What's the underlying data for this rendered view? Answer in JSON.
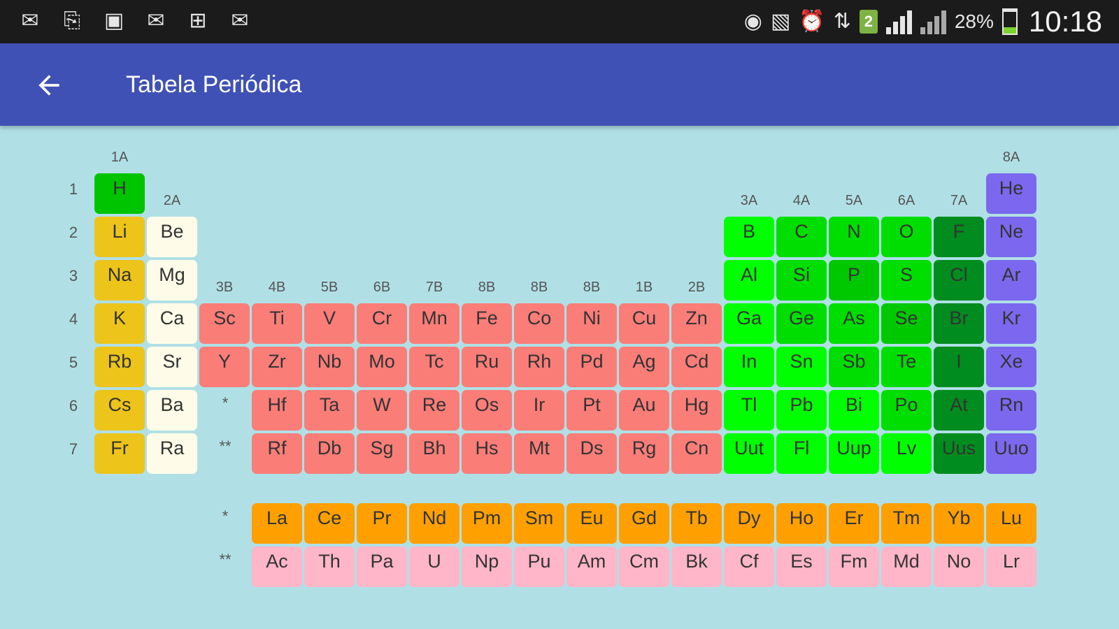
{
  "status_bar": {
    "left_icons": [
      "mail-icon",
      "sync-icon",
      "image-icon",
      "gmail-icon",
      "windows-icon",
      "gmail-icon"
    ],
    "sim_number": "2",
    "battery_percent": "28%",
    "battery_level": 0.28,
    "time": "10:18"
  },
  "app_bar": {
    "title": "Tabela Periódica"
  },
  "colors": {
    "alkali": "#ecc41a",
    "alkaline": "#fefce8",
    "transition": "#fa7d78",
    "lanthanide": "#ffa000",
    "actinide": "#ffb6c8",
    "hydrogen": "#00c400",
    "nonmetal": "#00dd00",
    "other_metal": "#00ff00",
    "metalloid": "#00c800",
    "halogen": "#008c1e",
    "noble": "#7b68ee"
  },
  "period_labels": [
    "1",
    "2",
    "3",
    "4",
    "5",
    "6",
    "7"
  ],
  "group_labels": [
    "1A",
    "2A",
    "3B",
    "4B",
    "5B",
    "6B",
    "7B",
    "8B",
    "8B",
    "8B",
    "1B",
    "2B",
    "3A",
    "4A",
    "5A",
    "6A",
    "7A",
    "8A"
  ],
  "star_labels": {
    "p6": "*",
    "p7": "**",
    "lanthanides": "*",
    "actinides": "**"
  },
  "main_table": [
    {
      "symbol": "H",
      "period": 1,
      "group": 1,
      "type": "hydrogen"
    },
    {
      "symbol": "He",
      "period": 1,
      "group": 18,
      "type": "noble"
    },
    {
      "symbol": "Li",
      "period": 2,
      "group": 1,
      "type": "alkali"
    },
    {
      "symbol": "Be",
      "period": 2,
      "group": 2,
      "type": "alkaline"
    },
    {
      "symbol": "B",
      "period": 2,
      "group": 13,
      "type": "other_metal"
    },
    {
      "symbol": "C",
      "period": 2,
      "group": 14,
      "type": "nonmetal"
    },
    {
      "symbol": "N",
      "period": 2,
      "group": 15,
      "type": "nonmetal"
    },
    {
      "symbol": "O",
      "period": 2,
      "group": 16,
      "type": "nonmetal"
    },
    {
      "symbol": "F",
      "period": 2,
      "group": 17,
      "type": "halogen"
    },
    {
      "symbol": "Ne",
      "period": 2,
      "group": 18,
      "type": "noble"
    },
    {
      "symbol": "Na",
      "period": 3,
      "group": 1,
      "type": "alkali"
    },
    {
      "symbol": "Mg",
      "period": 3,
      "group": 2,
      "type": "alkaline"
    },
    {
      "symbol": "Al",
      "period": 3,
      "group": 13,
      "type": "other_metal"
    },
    {
      "symbol": "Si",
      "period": 3,
      "group": 14,
      "type": "nonmetal"
    },
    {
      "symbol": "P",
      "period": 3,
      "group": 15,
      "type": "metalloid"
    },
    {
      "symbol": "S",
      "period": 3,
      "group": 16,
      "type": "nonmetal"
    },
    {
      "symbol": "Cl",
      "period": 3,
      "group": 17,
      "type": "halogen"
    },
    {
      "symbol": "Ar",
      "period": 3,
      "group": 18,
      "type": "noble"
    },
    {
      "symbol": "K",
      "period": 4,
      "group": 1,
      "type": "alkali"
    },
    {
      "symbol": "Ca",
      "period": 4,
      "group": 2,
      "type": "alkaline"
    },
    {
      "symbol": "Sc",
      "period": 4,
      "group": 3,
      "type": "transition"
    },
    {
      "symbol": "Ti",
      "period": 4,
      "group": 4,
      "type": "transition"
    },
    {
      "symbol": "V",
      "period": 4,
      "group": 5,
      "type": "transition"
    },
    {
      "symbol": "Cr",
      "period": 4,
      "group": 6,
      "type": "transition"
    },
    {
      "symbol": "Mn",
      "period": 4,
      "group": 7,
      "type": "transition"
    },
    {
      "symbol": "Fe",
      "period": 4,
      "group": 8,
      "type": "transition"
    },
    {
      "symbol": "Co",
      "period": 4,
      "group": 9,
      "type": "transition"
    },
    {
      "symbol": "Ni",
      "period": 4,
      "group": 10,
      "type": "transition"
    },
    {
      "symbol": "Cu",
      "period": 4,
      "group": 11,
      "type": "transition"
    },
    {
      "symbol": "Zn",
      "period": 4,
      "group": 12,
      "type": "transition"
    },
    {
      "symbol": "Ga",
      "period": 4,
      "group": 13,
      "type": "other_metal"
    },
    {
      "symbol": "Ge",
      "period": 4,
      "group": 14,
      "type": "nonmetal"
    },
    {
      "symbol": "As",
      "period": 4,
      "group": 15,
      "type": "nonmetal"
    },
    {
      "symbol": "Se",
      "period": 4,
      "group": 16,
      "type": "metalloid"
    },
    {
      "symbol": "Br",
      "period": 4,
      "group": 17,
      "type": "halogen"
    },
    {
      "symbol": "Kr",
      "period": 4,
      "group": 18,
      "type": "noble"
    },
    {
      "symbol": "Rb",
      "period": 5,
      "group": 1,
      "type": "alkali"
    },
    {
      "symbol": "Sr",
      "period": 5,
      "group": 2,
      "type": "alkaline"
    },
    {
      "symbol": "Y",
      "period": 5,
      "group": 3,
      "type": "transition"
    },
    {
      "symbol": "Zr",
      "period": 5,
      "group": 4,
      "type": "transition"
    },
    {
      "symbol": "Nb",
      "period": 5,
      "group": 5,
      "type": "transition"
    },
    {
      "symbol": "Mo",
      "period": 5,
      "group": 6,
      "type": "transition"
    },
    {
      "symbol": "Tc",
      "period": 5,
      "group": 7,
      "type": "transition"
    },
    {
      "symbol": "Ru",
      "period": 5,
      "group": 8,
      "type": "transition"
    },
    {
      "symbol": "Rh",
      "period": 5,
      "group": 9,
      "type": "transition"
    },
    {
      "symbol": "Pd",
      "period": 5,
      "group": 10,
      "type": "transition"
    },
    {
      "symbol": "Ag",
      "period": 5,
      "group": 11,
      "type": "transition"
    },
    {
      "symbol": "Cd",
      "period": 5,
      "group": 12,
      "type": "transition"
    },
    {
      "symbol": "In",
      "period": 5,
      "group": 13,
      "type": "other_metal"
    },
    {
      "symbol": "Sn",
      "period": 5,
      "group": 14,
      "type": "other_metal"
    },
    {
      "symbol": "Sb",
      "period": 5,
      "group": 15,
      "type": "nonmetal"
    },
    {
      "symbol": "Te",
      "period": 5,
      "group": 16,
      "type": "nonmetal"
    },
    {
      "symbol": "I",
      "period": 5,
      "group": 17,
      "type": "halogen"
    },
    {
      "symbol": "Xe",
      "period": 5,
      "group": 18,
      "type": "noble"
    },
    {
      "symbol": "Cs",
      "period": 6,
      "group": 1,
      "type": "alkali"
    },
    {
      "symbol": "Ba",
      "period": 6,
      "group": 2,
      "type": "alkaline"
    },
    {
      "symbol": "Hf",
      "period": 6,
      "group": 4,
      "type": "transition"
    },
    {
      "symbol": "Ta",
      "period": 6,
      "group": 5,
      "type": "transition"
    },
    {
      "symbol": "W",
      "period": 6,
      "group": 6,
      "type": "transition"
    },
    {
      "symbol": "Re",
      "period": 6,
      "group": 7,
      "type": "transition"
    },
    {
      "symbol": "Os",
      "period": 6,
      "group": 8,
      "type": "transition"
    },
    {
      "symbol": "Ir",
      "period": 6,
      "group": 9,
      "type": "transition"
    },
    {
      "symbol": "Pt",
      "period": 6,
      "group": 10,
      "type": "transition"
    },
    {
      "symbol": "Au",
      "period": 6,
      "group": 11,
      "type": "transition"
    },
    {
      "symbol": "Hg",
      "period": 6,
      "group": 12,
      "type": "transition"
    },
    {
      "symbol": "Tl",
      "period": 6,
      "group": 13,
      "type": "other_metal"
    },
    {
      "symbol": "Pb",
      "period": 6,
      "group": 14,
      "type": "other_metal"
    },
    {
      "symbol": "Bi",
      "period": 6,
      "group": 15,
      "type": "other_metal"
    },
    {
      "symbol": "Po",
      "period": 6,
      "group": 16,
      "type": "nonmetal"
    },
    {
      "symbol": "At",
      "period": 6,
      "group": 17,
      "type": "halogen"
    },
    {
      "symbol": "Rn",
      "period": 6,
      "group": 18,
      "type": "noble"
    },
    {
      "symbol": "Fr",
      "period": 7,
      "group": 1,
      "type": "alkali"
    },
    {
      "symbol": "Ra",
      "period": 7,
      "group": 2,
      "type": "alkaline"
    },
    {
      "symbol": "Rf",
      "period": 7,
      "group": 4,
      "type": "transition"
    },
    {
      "symbol": "Db",
      "period": 7,
      "group": 5,
      "type": "transition"
    },
    {
      "symbol": "Sg",
      "period": 7,
      "group": 6,
      "type": "transition"
    },
    {
      "symbol": "Bh",
      "period": 7,
      "group": 7,
      "type": "transition"
    },
    {
      "symbol": "Hs",
      "period": 7,
      "group": 8,
      "type": "transition"
    },
    {
      "symbol": "Mt",
      "period": 7,
      "group": 9,
      "type": "transition"
    },
    {
      "symbol": "Ds",
      "period": 7,
      "group": 10,
      "type": "transition"
    },
    {
      "symbol": "Rg",
      "period": 7,
      "group": 11,
      "type": "transition"
    },
    {
      "symbol": "Cn",
      "period": 7,
      "group": 12,
      "type": "transition"
    },
    {
      "symbol": "Uut",
      "period": 7,
      "group": 13,
      "type": "other_metal"
    },
    {
      "symbol": "Fl",
      "period": 7,
      "group": 14,
      "type": "other_metal"
    },
    {
      "symbol": "Uup",
      "period": 7,
      "group": 15,
      "type": "other_metal"
    },
    {
      "symbol": "Lv",
      "period": 7,
      "group": 16,
      "type": "other_metal"
    },
    {
      "symbol": "Uus",
      "period": 7,
      "group": 17,
      "type": "halogen"
    },
    {
      "symbol": "Uuo",
      "period": 7,
      "group": 18,
      "type": "noble"
    }
  ],
  "lanthanides": [
    "La",
    "Ce",
    "Pr",
    "Nd",
    "Pm",
    "Sm",
    "Eu",
    "Gd",
    "Tb",
    "Dy",
    "Ho",
    "Er",
    "Tm",
    "Yb",
    "Lu"
  ],
  "actinides": [
    "Ac",
    "Th",
    "Pa",
    "U",
    "Np",
    "Pu",
    "Am",
    "Cm",
    "Bk",
    "Cf",
    "Es",
    "Fm",
    "Md",
    "No",
    "Lr"
  ]
}
